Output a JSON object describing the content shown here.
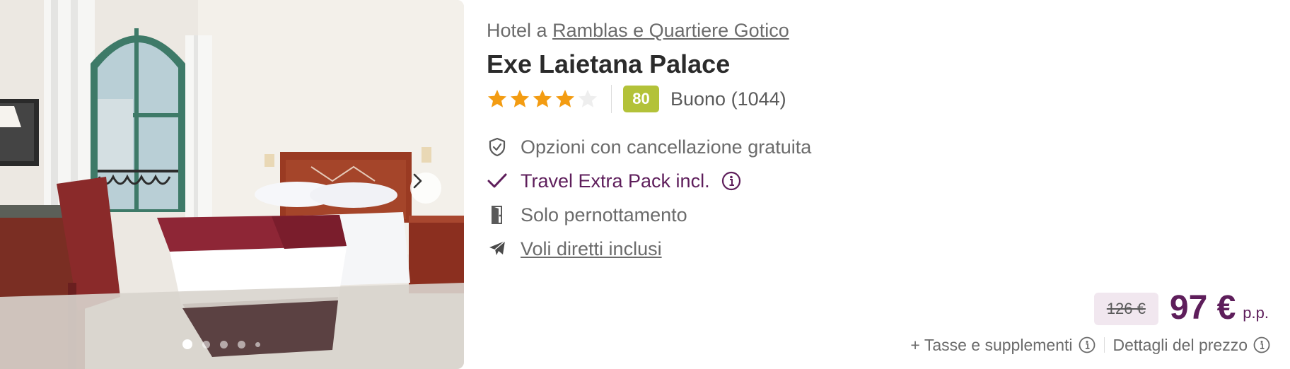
{
  "hotel": {
    "location_prefix": "Hotel a",
    "location_link": "Ramblas e Quartiere Gotico",
    "name": "Exe Laietana Palace",
    "stars": 4,
    "stars_max": 5,
    "score": "80",
    "score_label": "Buono (1044)"
  },
  "features": [
    {
      "icon": "shield-check-icon",
      "label": "Opzioni con cancellazione gratuita"
    },
    {
      "icon": "check-icon",
      "label": "Travel Extra Pack incl."
    },
    {
      "icon": "door-icon",
      "label": "Solo pernottamento"
    },
    {
      "icon": "plane-icon",
      "label": "Voli diretti inclusi"
    }
  ],
  "price": {
    "old": "126 €",
    "current": "97 €",
    "unit": "p.p.",
    "taxes_label": "+ Tasse e supplementi",
    "details_label": "Dettagli del prezzo"
  },
  "gallery": {
    "dot_count": 5,
    "active_index": 0
  },
  "colors": {
    "brand_purple": "#5e1e5b",
    "score_green": "#b3c239",
    "star_orange": "#f39c12",
    "old_price_bg": "#f1e7ef"
  }
}
